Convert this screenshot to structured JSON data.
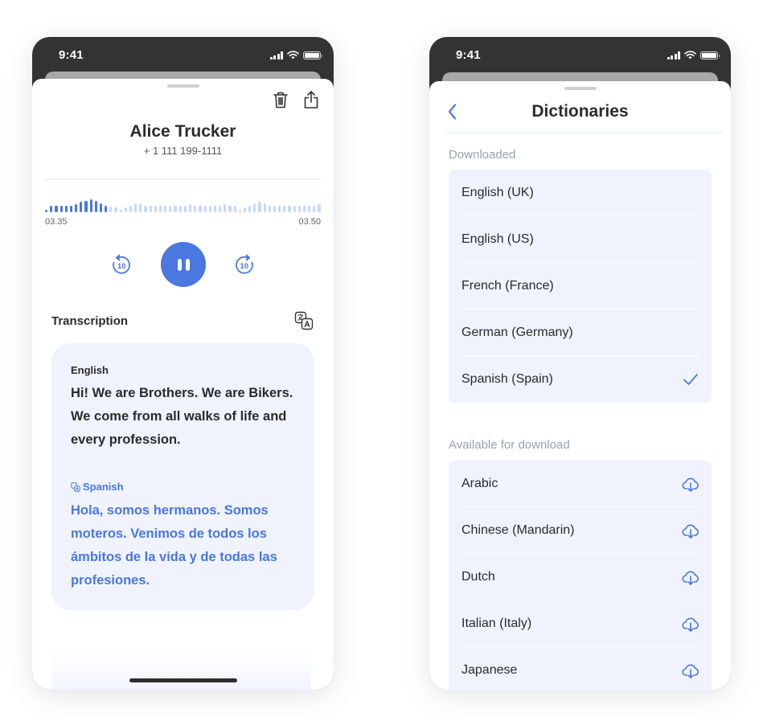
{
  "status_bar": {
    "time": "9:41"
  },
  "recording": {
    "contact_name": "Alice Trucker",
    "contact_phone": "+ 1 111 199-1111",
    "actions": {
      "delete_icon": "trash-icon",
      "share_icon": "share-icon"
    },
    "playback": {
      "time_start": "03.35",
      "time_end": "03.50",
      "state": "playing",
      "skip_back_seconds": "10",
      "skip_forward_seconds": "10",
      "progress_fraction": 0.23,
      "waveform_levels": [
        0.15,
        0.45,
        0.45,
        0.45,
        0.45,
        0.45,
        0.55,
        0.7,
        0.8,
        0.9,
        0.8,
        0.6,
        0.45,
        0.4,
        0.35,
        0.15,
        0.35,
        0.45,
        0.6,
        0.6,
        0.45,
        0.45,
        0.45,
        0.45,
        0.45,
        0.45,
        0.45,
        0.45,
        0.45,
        0.55,
        0.45,
        0.45,
        0.45,
        0.45,
        0.45,
        0.45,
        0.55,
        0.45,
        0.45,
        0.15,
        0.35,
        0.45,
        0.6,
        0.7,
        0.6,
        0.45,
        0.45,
        0.45,
        0.45,
        0.45,
        0.45,
        0.45,
        0.45,
        0.45,
        0.45,
        0.55
      ]
    },
    "transcription": {
      "title": "Transcription",
      "source_language": "English",
      "source_text": "Hi! We are Brothers. We are Bikers. We come from all walks of life and every profession.",
      "target_language": "Spanish",
      "target_text": "Hola, somos hermanos. Somos moteros. Venimos de todos los ámbitos de la vida y de todas las profesiones."
    }
  },
  "dictionaries": {
    "title": "Dictionaries",
    "downloaded_label": "Downloaded",
    "downloaded": [
      {
        "name": "English (UK)",
        "selected": false
      },
      {
        "name": "English (US)",
        "selected": false
      },
      {
        "name": "French (France)",
        "selected": false
      },
      {
        "name": "German (Germany)",
        "selected": false
      },
      {
        "name": "Spanish (Spain)",
        "selected": true
      }
    ],
    "available_label": "Available for download",
    "available": [
      {
        "name": "Arabic"
      },
      {
        "name": "Chinese (Mandarin)"
      },
      {
        "name": "Dutch"
      },
      {
        "name": "Italian (Italy)"
      },
      {
        "name": "Japanese"
      }
    ]
  },
  "colors": {
    "accent": "#4a77e0",
    "accent_light": "#c9d6f7",
    "card_bg": "#f0f3fe",
    "status_bar": "#333333",
    "muted_label": "#9aa2ad"
  }
}
